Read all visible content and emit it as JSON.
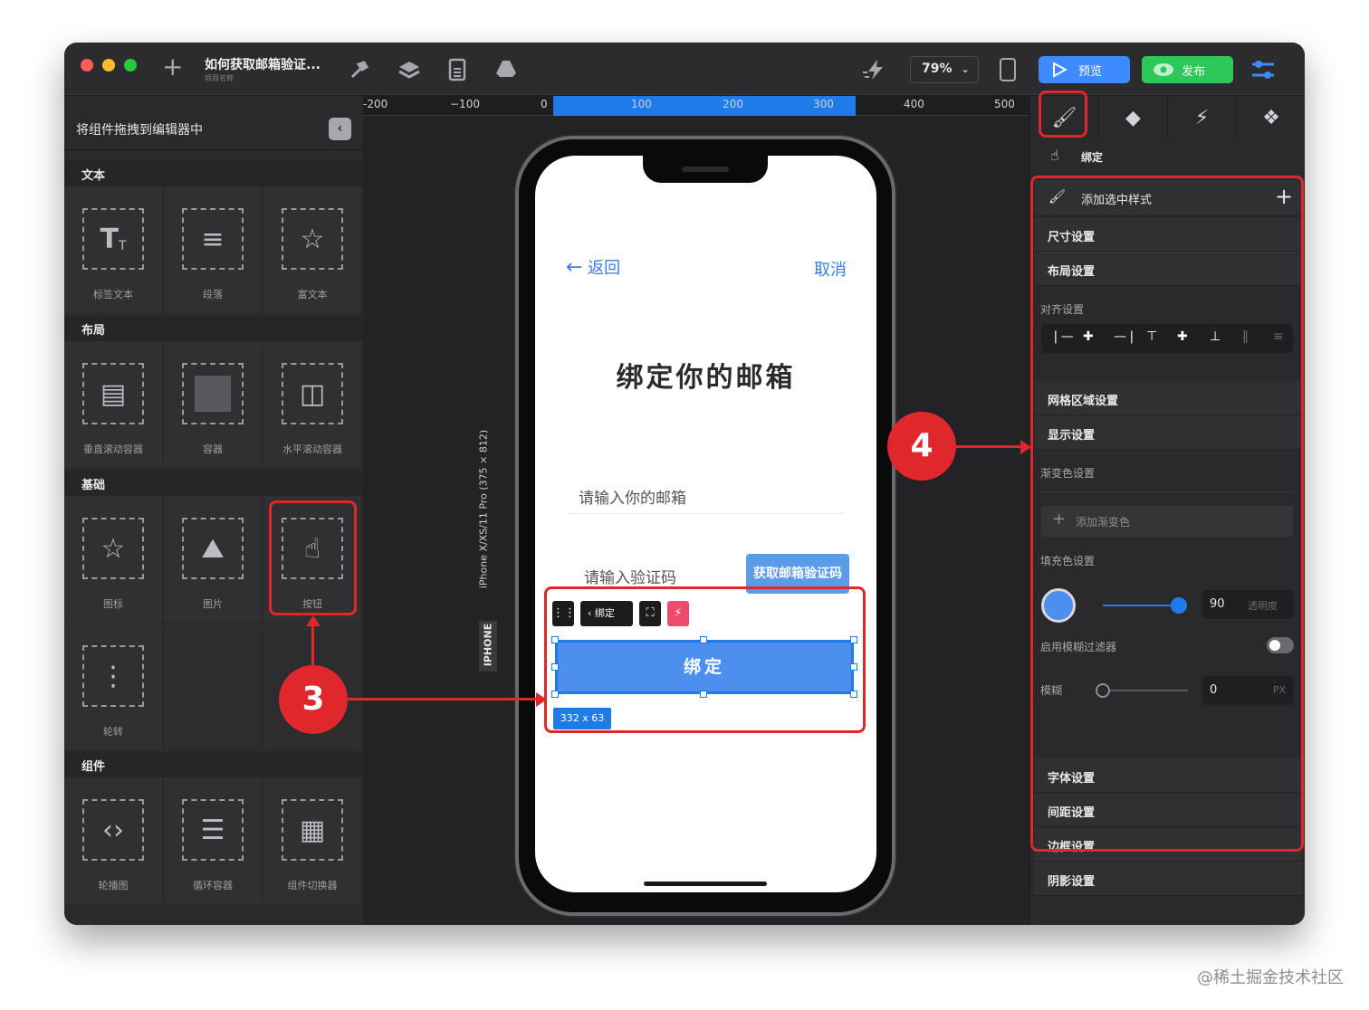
{
  "titlebar": {
    "project_title": "如何获取邮箱验证...",
    "project_subtitle": "项目名称",
    "zoom": "79%",
    "preview_label": "预览",
    "publish_label": "发布"
  },
  "left_panel": {
    "header": "将组件拖拽到编辑器中",
    "sections": [
      {
        "title": "文本",
        "items": [
          "标签文本",
          "段落",
          "富文本"
        ]
      },
      {
        "title": "布局",
        "items": [
          "垂直滚动容器",
          "容器",
          "水平滚动容器"
        ]
      },
      {
        "title": "基础",
        "items": [
          "图标",
          "图片",
          "按钮",
          "轮转"
        ]
      },
      {
        "title": "组件",
        "items": [
          "轮播图",
          "循环容器",
          "组件切换器"
        ]
      }
    ]
  },
  "ruler": {
    "labels": [
      "-200",
      "−100",
      "0",
      "100",
      "200",
      "300",
      "400",
      "500"
    ]
  },
  "device": {
    "name": "iPhone X/XS/11 Pro (375 × 812)",
    "label": "IPHONE"
  },
  "phone": {
    "back": "返回",
    "cancel": "取消",
    "heading": "绑定你的邮箱",
    "email_placeholder": "请输入你的邮箱",
    "code_placeholder": "请输入验证码",
    "get_code": "获取邮箱验证码",
    "toolbar_label": "绑定",
    "bind_button": "绑定",
    "size_badge": "332 x 63"
  },
  "right_panel": {
    "component_name": "绑定",
    "add_style": "添加选中样式",
    "size": "尺寸设置",
    "layout": "布局设置",
    "align": "对齐设置",
    "grid": "网格区域设置",
    "display": "显示设置",
    "gradient": "渐变色设置",
    "add_gradient": "添加渐变色",
    "fill": "填充色设置",
    "opacity_value": "90",
    "opacity_label": "透明度",
    "fill_color": "#4d8fee",
    "blur_filter": "启用模糊过滤器",
    "blur": "模糊",
    "blur_value": "0",
    "blur_unit": "PX",
    "font": "字体设置",
    "spacing": "间距设置",
    "border": "边框设置",
    "shadow": "阴影设置"
  },
  "annotations": {
    "step3": "3",
    "step4": "4"
  },
  "watermark": "@稀土掘金技术社区"
}
